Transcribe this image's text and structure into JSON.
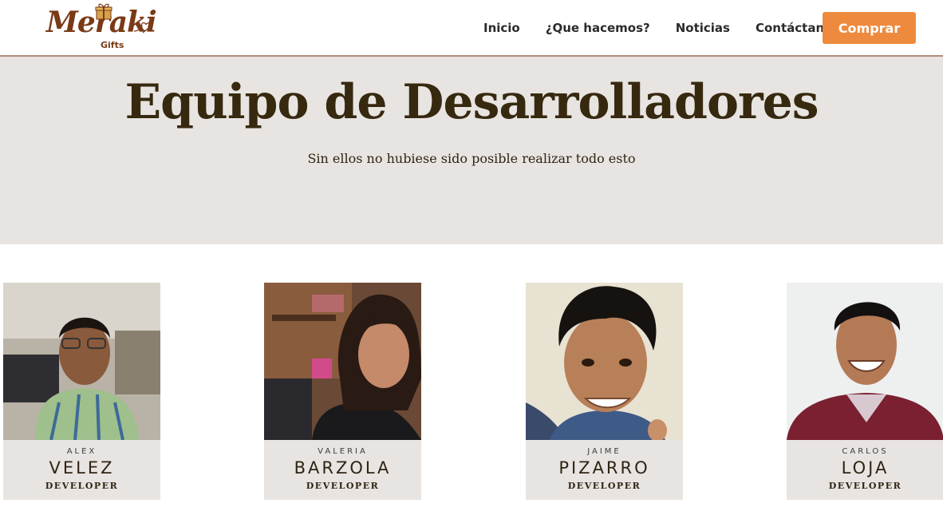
{
  "header": {
    "logo_text": "Meraki",
    "logo_subtext": "Gifts",
    "nav": [
      "Inicio",
      "¿Que hacemos?",
      "Noticias",
      "Contáctanos"
    ],
    "buy_label": "Comprar",
    "accent_color": "#ee8a3e"
  },
  "hero": {
    "title": "Equipo de Desarrolladores",
    "subtitle": "Sin ellos no hubiese sido posible realizar todo esto"
  },
  "team": [
    {
      "first": "ALEX",
      "last": "VELEZ",
      "role": "DEVELOPER"
    },
    {
      "first": "VALERIA",
      "last": "BARZOLA",
      "role": "DEVELOPER"
    },
    {
      "first": "JAIME",
      "last": "PIZARRO",
      "role": "DEVELOPER"
    },
    {
      "first": "CARLOS",
      "last": "LOJA",
      "role": "DEVELOPER"
    }
  ]
}
